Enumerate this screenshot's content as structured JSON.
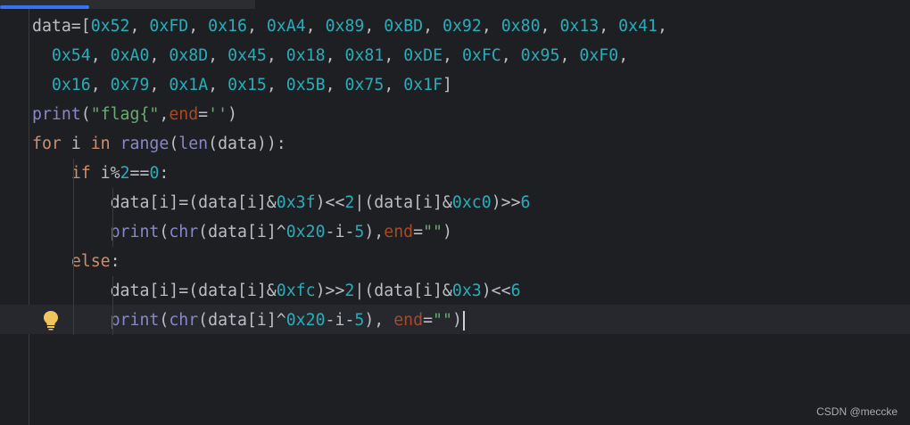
{
  "editor": {
    "lines": [
      [
        {
          "t": "data=[",
          "c": "p"
        },
        {
          "t": "0x52",
          "c": "n"
        },
        {
          "t": ", ",
          "c": "p"
        },
        {
          "t": "0xFD",
          "c": "n"
        },
        {
          "t": ", ",
          "c": "p"
        },
        {
          "t": "0x16",
          "c": "n"
        },
        {
          "t": ", ",
          "c": "p"
        },
        {
          "t": "0xA4",
          "c": "n"
        },
        {
          "t": ", ",
          "c": "p"
        },
        {
          "t": "0x89",
          "c": "n"
        },
        {
          "t": ", ",
          "c": "p"
        },
        {
          "t": "0xBD",
          "c": "n"
        },
        {
          "t": ", ",
          "c": "p"
        },
        {
          "t": "0x92",
          "c": "n"
        },
        {
          "t": ", ",
          "c": "p"
        },
        {
          "t": "0x80",
          "c": "n"
        },
        {
          "t": ", ",
          "c": "p"
        },
        {
          "t": "0x13",
          "c": "n"
        },
        {
          "t": ", ",
          "c": "p"
        },
        {
          "t": "0x41",
          "c": "n"
        },
        {
          "t": ",",
          "c": "p"
        }
      ],
      [
        {
          "t": "  ",
          "c": "p"
        },
        {
          "t": "0x54",
          "c": "n"
        },
        {
          "t": ", ",
          "c": "p"
        },
        {
          "t": "0xA0",
          "c": "n"
        },
        {
          "t": ", ",
          "c": "p"
        },
        {
          "t": "0x8D",
          "c": "n"
        },
        {
          "t": ", ",
          "c": "p"
        },
        {
          "t": "0x45",
          "c": "n"
        },
        {
          "t": ", ",
          "c": "p"
        },
        {
          "t": "0x18",
          "c": "n"
        },
        {
          "t": ", ",
          "c": "p"
        },
        {
          "t": "0x81",
          "c": "n"
        },
        {
          "t": ", ",
          "c": "p"
        },
        {
          "t": "0xDE",
          "c": "n"
        },
        {
          "t": ", ",
          "c": "p"
        },
        {
          "t": "0xFC",
          "c": "n"
        },
        {
          "t": ", ",
          "c": "p"
        },
        {
          "t": "0x95",
          "c": "n"
        },
        {
          "t": ", ",
          "c": "p"
        },
        {
          "t": "0xF0",
          "c": "n"
        },
        {
          "t": ",",
          "c": "p"
        }
      ],
      [
        {
          "t": "  ",
          "c": "p"
        },
        {
          "t": "0x16",
          "c": "n"
        },
        {
          "t": ", ",
          "c": "p"
        },
        {
          "t": "0x79",
          "c": "n"
        },
        {
          "t": ", ",
          "c": "p"
        },
        {
          "t": "0x1A",
          "c": "n"
        },
        {
          "t": ", ",
          "c": "p"
        },
        {
          "t": "0x15",
          "c": "n"
        },
        {
          "t": ", ",
          "c": "p"
        },
        {
          "t": "0x5B",
          "c": "n"
        },
        {
          "t": ", ",
          "c": "p"
        },
        {
          "t": "0x75",
          "c": "n"
        },
        {
          "t": ", ",
          "c": "p"
        },
        {
          "t": "0x1F",
          "c": "n"
        },
        {
          "t": "]",
          "c": "p"
        }
      ],
      [
        {
          "t": "print",
          "c": "b"
        },
        {
          "t": "(",
          "c": "p"
        },
        {
          "t": "\"flag{\"",
          "c": "s"
        },
        {
          "t": ",",
          "c": "p"
        },
        {
          "t": "end",
          "c": "kp"
        },
        {
          "t": "=",
          "c": "p"
        },
        {
          "t": "''",
          "c": "s"
        },
        {
          "t": ")",
          "c": "p"
        }
      ],
      [
        {
          "t": "for",
          "c": "kw"
        },
        {
          "t": " i ",
          "c": "p"
        },
        {
          "t": "in",
          "c": "kw"
        },
        {
          "t": " ",
          "c": "p"
        },
        {
          "t": "range",
          "c": "b"
        },
        {
          "t": "(",
          "c": "p"
        },
        {
          "t": "len",
          "c": "b"
        },
        {
          "t": "(data)):",
          "c": "p"
        }
      ],
      [
        {
          "t": "    ",
          "c": "p"
        },
        {
          "t": "if",
          "c": "kw"
        },
        {
          "t": " i%",
          "c": "p"
        },
        {
          "t": "2",
          "c": "n"
        },
        {
          "t": "==",
          "c": "p"
        },
        {
          "t": "0",
          "c": "n"
        },
        {
          "t": ":",
          "c": "p"
        }
      ],
      [
        {
          "t": "        data[i]=(data[i]&",
          "c": "p"
        },
        {
          "t": "0x3f",
          "c": "n"
        },
        {
          "t": ")<<",
          "c": "p"
        },
        {
          "t": "2",
          "c": "n"
        },
        {
          "t": "|(data[i]&",
          "c": "p"
        },
        {
          "t": "0xc0",
          "c": "n"
        },
        {
          "t": ")>>",
          "c": "p"
        },
        {
          "t": "6",
          "c": "n"
        }
      ],
      [
        {
          "t": "        ",
          "c": "p"
        },
        {
          "t": "print",
          "c": "b"
        },
        {
          "t": "(",
          "c": "p"
        },
        {
          "t": "chr",
          "c": "b"
        },
        {
          "t": "(data[i]^",
          "c": "p"
        },
        {
          "t": "0x20",
          "c": "n"
        },
        {
          "t": "-i-",
          "c": "p"
        },
        {
          "t": "5",
          "c": "n"
        },
        {
          "t": "),",
          "c": "p"
        },
        {
          "t": "end",
          "c": "kp"
        },
        {
          "t": "=",
          "c": "p"
        },
        {
          "t": "\"\"",
          "c": "s"
        },
        {
          "t": ")",
          "c": "p"
        }
      ],
      [
        {
          "t": "    ",
          "c": "p"
        },
        {
          "t": "else",
          "c": "kw"
        },
        {
          "t": ":",
          "c": "p"
        }
      ],
      [
        {
          "t": "        data[i]=(data[i]&",
          "c": "p"
        },
        {
          "t": "0xfc",
          "c": "n"
        },
        {
          "t": ")>>",
          "c": "p"
        },
        {
          "t": "2",
          "c": "n"
        },
        {
          "t": "|(data[i]&",
          "c": "p"
        },
        {
          "t": "0x3",
          "c": "n"
        },
        {
          "t": ")<<",
          "c": "p"
        },
        {
          "t": "6",
          "c": "n"
        }
      ],
      [
        {
          "t": "        ",
          "c": "p"
        },
        {
          "t": "print",
          "c": "b"
        },
        {
          "t": "(",
          "c": "p"
        },
        {
          "t": "chr",
          "c": "b"
        },
        {
          "t": "(data[i]^",
          "c": "p"
        },
        {
          "t": "0x20",
          "c": "n"
        },
        {
          "t": "-i-",
          "c": "p"
        },
        {
          "t": "5",
          "c": "n"
        },
        {
          "t": "), ",
          "c": "p"
        },
        {
          "t": "end",
          "c": "kp"
        },
        {
          "t": "=",
          "c": "p"
        },
        {
          "t": "\"\"",
          "c": "s"
        },
        {
          "t": ")",
          "c": "p"
        }
      ]
    ],
    "current_line": 11,
    "intention_icon": "lightbulb-icon"
  },
  "watermark": "CSDN @meccke",
  "colors": {
    "background": "#1e1f22",
    "number": "#2aacb8",
    "string": "#6aab73",
    "keyword": "#cf8e6d",
    "builtin": "#8888c6",
    "named_arg": "#aa4926",
    "text": "#bcbec4",
    "tab_accent": "#3574f0"
  }
}
